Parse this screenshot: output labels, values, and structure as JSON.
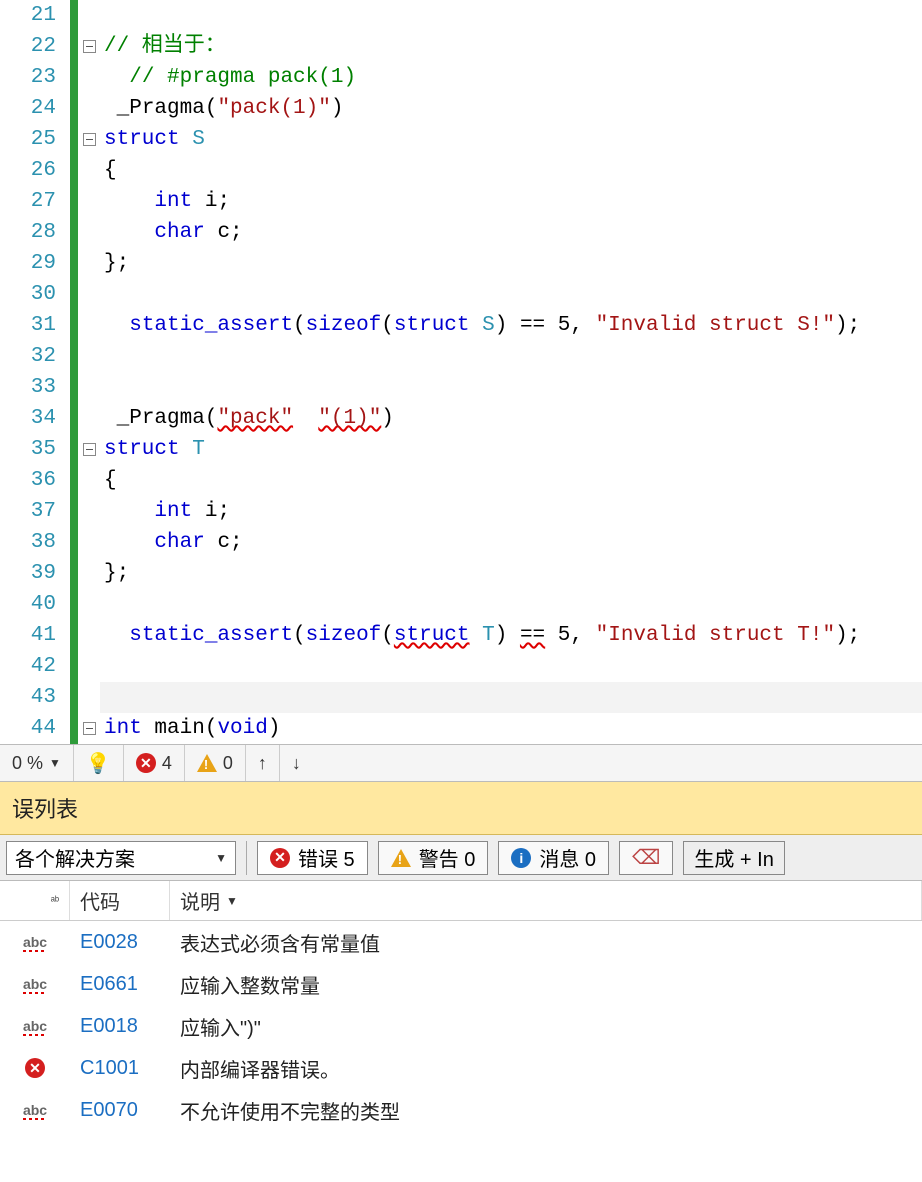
{
  "editor": {
    "lines": [
      {
        "n": 21,
        "fold": null
      },
      {
        "n": 22,
        "fold": "minus"
      },
      {
        "n": 23,
        "fold": null
      },
      {
        "n": 24,
        "fold": null
      },
      {
        "n": 25,
        "fold": "minus"
      },
      {
        "n": 26,
        "fold": null
      },
      {
        "n": 27,
        "fold": null
      },
      {
        "n": 28,
        "fold": null
      },
      {
        "n": 29,
        "fold": null
      },
      {
        "n": 30,
        "fold": null
      },
      {
        "n": 31,
        "fold": null
      },
      {
        "n": 32,
        "fold": null
      },
      {
        "n": 33,
        "fold": null
      },
      {
        "n": 34,
        "fold": null
      },
      {
        "n": 35,
        "fold": "minus"
      },
      {
        "n": 36,
        "fold": null
      },
      {
        "n": 37,
        "fold": null
      },
      {
        "n": 38,
        "fold": null
      },
      {
        "n": 39,
        "fold": null
      },
      {
        "n": 40,
        "fold": null
      },
      {
        "n": 41,
        "fold": null
      },
      {
        "n": 42,
        "fold": null
      },
      {
        "n": 43,
        "fold": null
      },
      {
        "n": 44,
        "fold": "minus"
      }
    ],
    "code": {
      "l22_comment": "// 相当于：",
      "l23_comment": "// #pragma pack(1)",
      "l24_pragma": "_Pragma",
      "l24_arg": "\"pack(1)\"",
      "l25_struct": "struct",
      "l25_name": "S",
      "l27_int": "int",
      "l27_var": "i;",
      "l28_char": "char",
      "l28_var": "c;",
      "l31_sa": "static_assert",
      "l31_sizeof": "sizeof",
      "l31_struct": "struct",
      "l31_S": "S",
      "l31_eq": "== 5,",
      "l31_msg": "\"Invalid struct S!\"",
      "l34_pragma": "_Pragma",
      "l34_arg1": "\"pack\"",
      "l34_arg2": "\"(1)\"",
      "l35_struct": "struct",
      "l35_name": "T",
      "l37_int": "int",
      "l37_var": "i;",
      "l38_char": "char",
      "l38_var": "c;",
      "l41_sa": "static_assert",
      "l41_sizeof": "sizeof",
      "l41_struct": "struct",
      "l41_T": "T",
      "l41_eq": "==",
      "l41_5": "5,",
      "l41_msg": "\"Invalid struct T!\"",
      "l44_int": "int",
      "l44_main": "main",
      "l44_void": "void",
      "brace_open": "{",
      "brace_close": "};",
      "paren_open": "(",
      "paren_close": ")",
      "paren_close_semi": ");"
    }
  },
  "statusbar": {
    "zoom": "0 %",
    "errors_count": "4",
    "warnings_count": "0",
    "arrow_up": "↑",
    "arrow_down": "↓"
  },
  "panel": {
    "title": "误列表",
    "scope": "各个解决方案",
    "errors_label": "错误 5",
    "warnings_label": "警告 0",
    "info_label": "消息 0",
    "build_label": "生成 + In",
    "headers": {
      "code": "代码",
      "desc": "说明"
    },
    "rows": [
      {
        "icon": "abc",
        "code": "E0028",
        "desc": "表达式必须含有常量值"
      },
      {
        "icon": "abc",
        "code": "E0661",
        "desc": "应输入整数常量"
      },
      {
        "icon": "abc",
        "code": "E0018",
        "desc": "应输入\")\""
      },
      {
        "icon": "err",
        "code": "C1001",
        "desc": "内部编译器错误。"
      },
      {
        "icon": "abc",
        "code": "E0070",
        "desc": "不允许使用不完整的类型"
      }
    ]
  }
}
